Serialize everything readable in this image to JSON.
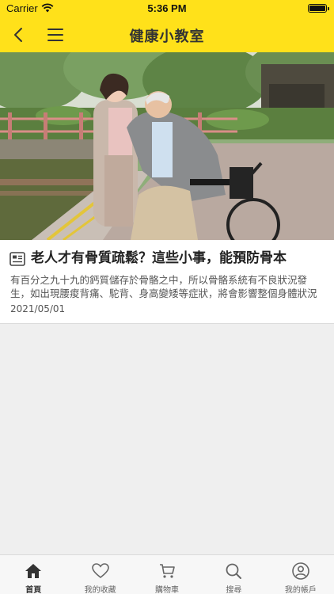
{
  "status_bar": {
    "carrier": "Carrier",
    "time": "5:36 PM"
  },
  "header": {
    "title": "健康小教室",
    "back_icon": "chevron-left-icon",
    "menu_icon": "hamburger-menu-icon"
  },
  "article": {
    "title": "老人才有骨質疏鬆？這些小事，能預防骨本",
    "summary": "有百分之九十九的鈣質儲存於骨骼之中，所以骨骼系統有不良狀況發生，如出現腰痠背痛、駝背、身高變矮等症狀，將會影響整個身體狀況",
    "date": "2021/05/01",
    "icon": "document-icon"
  },
  "tabbar": {
    "items": [
      {
        "label": "首頁",
        "icon": "home-icon"
      },
      {
        "label": "我的收藏",
        "icon": "heart-icon"
      },
      {
        "label": "購物車",
        "icon": "cart-icon"
      },
      {
        "label": "搜尋",
        "icon": "search-icon"
      },
      {
        "label": "我的帳戶",
        "icon": "user-icon"
      }
    ],
    "active_index": 0
  },
  "colors": {
    "brand_yellow": "#ffe11a",
    "background": "#efefef"
  }
}
